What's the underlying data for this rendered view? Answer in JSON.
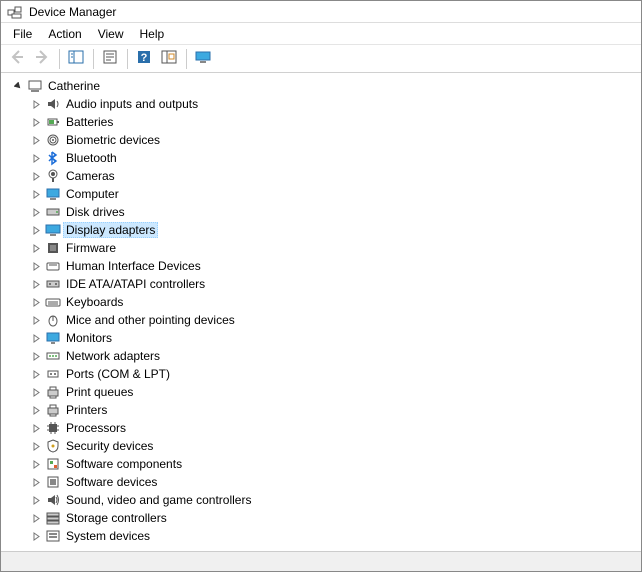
{
  "window_title": "Device Manager",
  "menubar": {
    "file": "File",
    "action": "Action",
    "view": "View",
    "help": "Help"
  },
  "root": {
    "label": "Catherine",
    "expanded": true
  },
  "categories": [
    {
      "key": "audio",
      "label": "Audio inputs and outputs",
      "expanded": false,
      "selected": false
    },
    {
      "key": "batteries",
      "label": "Batteries",
      "expanded": false,
      "selected": false
    },
    {
      "key": "biometric",
      "label": "Biometric devices",
      "expanded": false,
      "selected": false
    },
    {
      "key": "bluetooth",
      "label": "Bluetooth",
      "expanded": false,
      "selected": false
    },
    {
      "key": "cameras",
      "label": "Cameras",
      "expanded": false,
      "selected": false
    },
    {
      "key": "computer",
      "label": "Computer",
      "expanded": false,
      "selected": false
    },
    {
      "key": "disk",
      "label": "Disk drives",
      "expanded": false,
      "selected": false
    },
    {
      "key": "display",
      "label": "Display adapters",
      "expanded": false,
      "selected": true
    },
    {
      "key": "firmware",
      "label": "Firmware",
      "expanded": false,
      "selected": false
    },
    {
      "key": "hid",
      "label": "Human Interface Devices",
      "expanded": false,
      "selected": false
    },
    {
      "key": "ide",
      "label": "IDE ATA/ATAPI controllers",
      "expanded": false,
      "selected": false
    },
    {
      "key": "keyboards",
      "label": "Keyboards",
      "expanded": false,
      "selected": false
    },
    {
      "key": "mice",
      "label": "Mice and other pointing devices",
      "expanded": false,
      "selected": false
    },
    {
      "key": "monitors",
      "label": "Monitors",
      "expanded": false,
      "selected": false
    },
    {
      "key": "network",
      "label": "Network adapters",
      "expanded": false,
      "selected": false
    },
    {
      "key": "ports",
      "label": "Ports (COM & LPT)",
      "expanded": false,
      "selected": false
    },
    {
      "key": "printq",
      "label": "Print queues",
      "expanded": false,
      "selected": false
    },
    {
      "key": "printers",
      "label": "Printers",
      "expanded": false,
      "selected": false
    },
    {
      "key": "processors",
      "label": "Processors",
      "expanded": false,
      "selected": false
    },
    {
      "key": "security",
      "label": "Security devices",
      "expanded": false,
      "selected": false
    },
    {
      "key": "swcomp",
      "label": "Software components",
      "expanded": false,
      "selected": false
    },
    {
      "key": "swdev",
      "label": "Software devices",
      "expanded": false,
      "selected": false
    },
    {
      "key": "sound",
      "label": "Sound, video and game controllers",
      "expanded": false,
      "selected": false
    },
    {
      "key": "storage",
      "label": "Storage controllers",
      "expanded": false,
      "selected": false
    },
    {
      "key": "system",
      "label": "System devices",
      "expanded": false,
      "selected": false
    }
  ]
}
